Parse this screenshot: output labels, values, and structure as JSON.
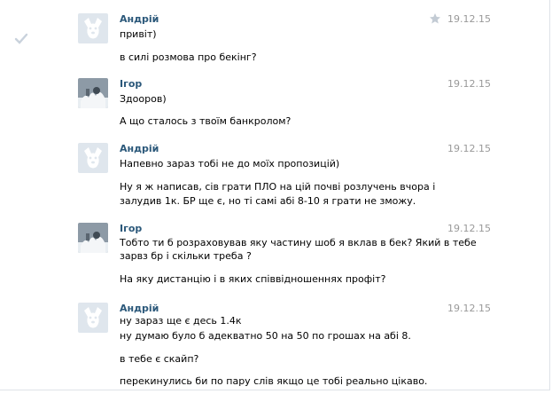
{
  "messages": [
    {
      "author": "Андрій",
      "date": "19.12.15",
      "avatar": "dog-icon",
      "starred": true,
      "checked": true,
      "lines": [
        "привіт)",
        "в силі розмова про бекінг?"
      ]
    },
    {
      "author": "Ігор",
      "date": "19.12.15",
      "avatar": "photo",
      "lines": [
        "Здооров)",
        "А що сталось з твоїм банкролом?"
      ]
    },
    {
      "author": "Андрій",
      "date": "19.12.15",
      "avatar": "dog-icon",
      "lines": [
        "Напевно зараз тобі не до моїх пропозицій)",
        "Ну я ж написав, сів грати ПЛО на цій почві розлучень вчора і",
        "залудив 1к. БР ще є, но ті самі абі 8-10 я грати не зможу."
      ]
    },
    {
      "author": "Ігор",
      "date": "19.12.15",
      "avatar": "photo",
      "lines": [
        "Тобто ти б розраховував яку частину шоб я вклав в бек? Який в тебе",
        "зарвз бр і скільки треба ?",
        "На яку дистанцію і в яких співвідношеннях профіт?"
      ]
    },
    {
      "author": "Андрій",
      "date": "19.12.15",
      "avatar": "dog-icon",
      "lines": [
        "ну зараз ще є десь 1.4к",
        "ну думаю було б адекватно 50 на 50 по грошах на абі 8.",
        "в тебе є скайп?",
        "перекинулись би по пару слів якщо це тобі реально цікаво."
      ]
    }
  ]
}
